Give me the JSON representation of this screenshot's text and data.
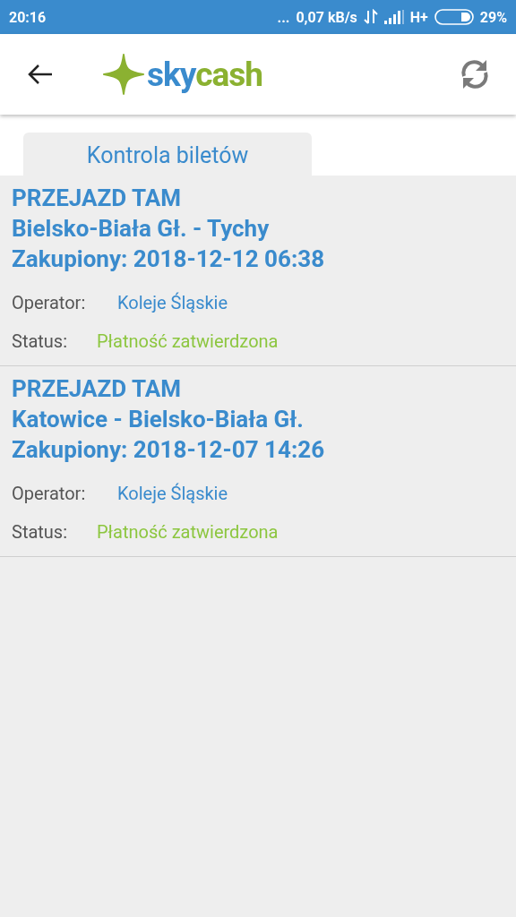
{
  "status_bar": {
    "time": "20:16",
    "dots": "...",
    "speed": "0,07 kB/s",
    "network": "H+",
    "battery": "29%"
  },
  "header": {
    "logo": [
      "sky",
      "cash"
    ]
  },
  "tabs": [
    {
      "label": "Kontrola biletów"
    }
  ],
  "tickets": [
    {
      "direction": "PRZEJAZD TAM",
      "route": "Bielsko-Biała Gł. - Tychy",
      "purchased": "Zakupiony: 2018-12-12 06:38",
      "operator_label": "Operator:",
      "operator": "Koleje Śląskie",
      "status_label": "Status:",
      "status": "Płatność zatwierdzona"
    },
    {
      "direction": "PRZEJAZD TAM",
      "route": "Katowice - Bielsko-Biała Gł.",
      "purchased": "Zakupiony: 2018-12-07 14:26",
      "operator_label": "Operator:",
      "operator": "Koleje Śląskie",
      "status_label": "Status:",
      "status": "Płatność zatwierdzona"
    }
  ]
}
